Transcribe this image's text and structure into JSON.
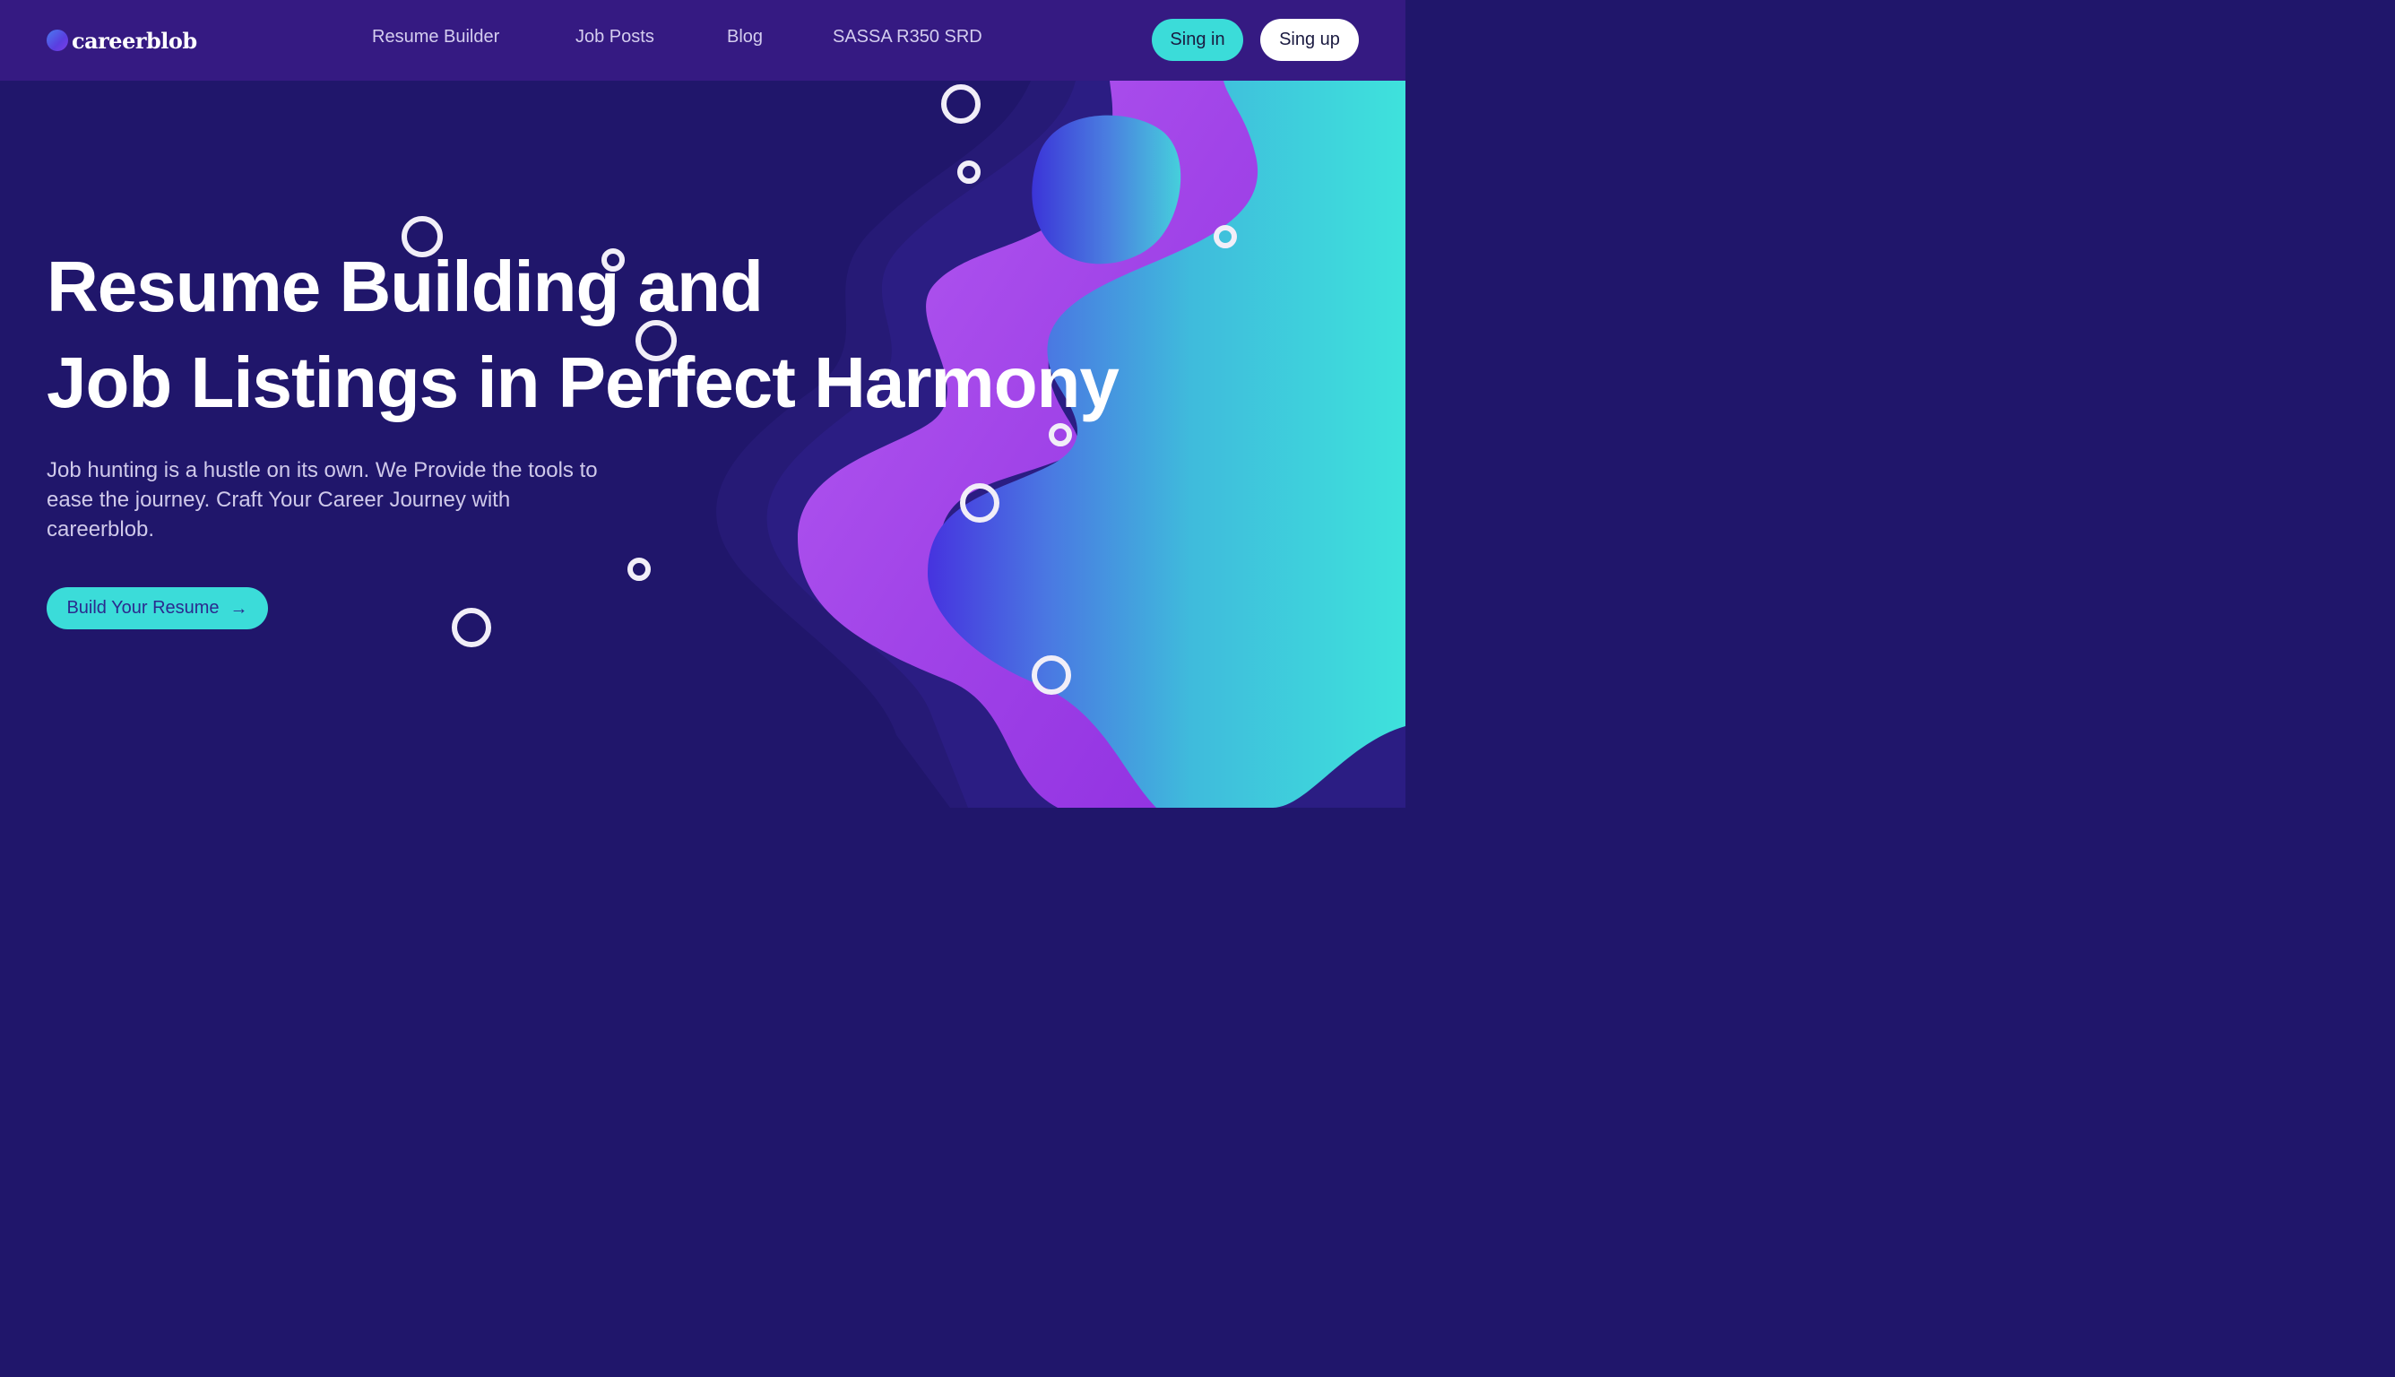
{
  "nav": {
    "logo_text": "careerblob",
    "links": [
      "Resume Builder",
      "Job Posts",
      "Blog",
      "SASSA R350 SRD"
    ],
    "signin_label": "Sing in",
    "signup_label": "Sing up"
  },
  "hero": {
    "title_line1": "Resume Building and",
    "title_line2": "Job Listings in Perfect Harmony",
    "description": "Job hunting is a hustle on its own. We Provide the tools to ease the journey. Craft Your Career Journey with careerblob.",
    "cta_label": "Build Your Resume",
    "cta_icon": "arrow-right-icon"
  },
  "colors": {
    "nav_bg": "#351a82",
    "page_bg": "#20166b",
    "accent_teal": "#3bdcd9",
    "accent_purple": "#a445e8",
    "accent_blue": "#4a4fe0"
  }
}
